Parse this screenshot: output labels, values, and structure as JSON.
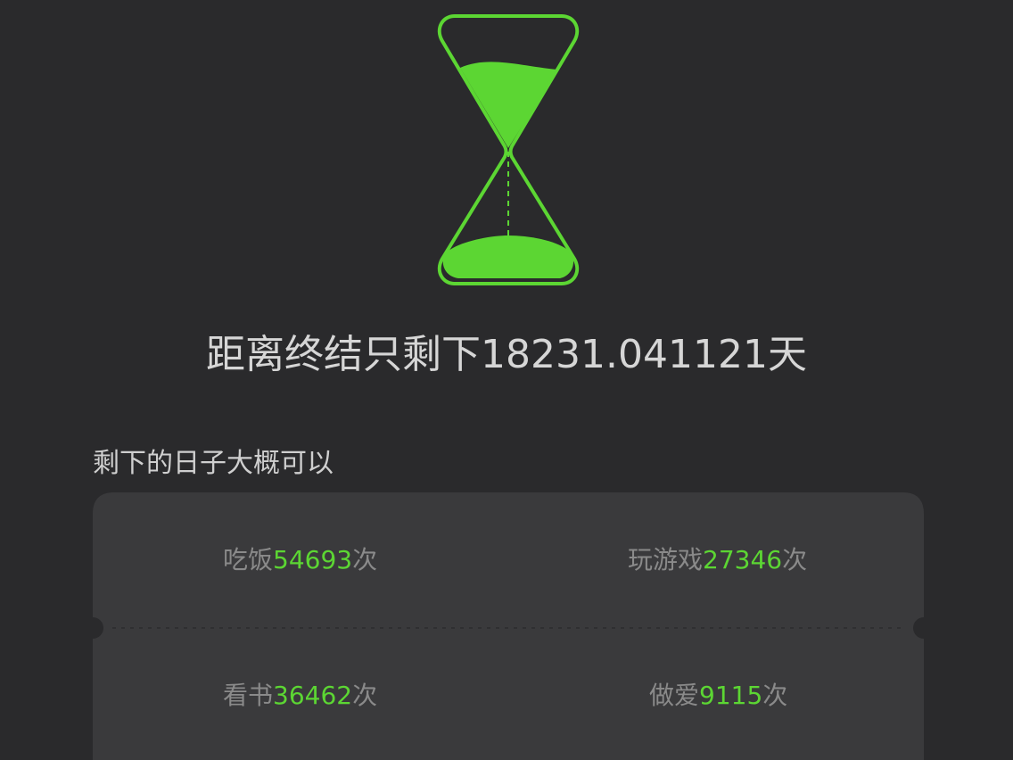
{
  "countdown": {
    "prefix": "距离终结只剩下",
    "value": "18231.041121",
    "suffix": "天"
  },
  "section_title": "剩下的日子大概可以",
  "stats": [
    {
      "label": "吃饭",
      "value": "54693",
      "unit": "次"
    },
    {
      "label": "玩游戏",
      "value": "27346",
      "unit": "次"
    },
    {
      "label": "看书",
      "value": "36462",
      "unit": "次"
    },
    {
      "label": "做爱",
      "value": "9115",
      "unit": "次"
    }
  ],
  "colors": {
    "background": "#2a2a2c",
    "card": "#3a3a3c",
    "accent": "#5cd633",
    "headline_text": "#d6d6d6",
    "muted_text": "#8a8a8a"
  },
  "icons": {
    "hourglass": "hourglass-icon"
  }
}
